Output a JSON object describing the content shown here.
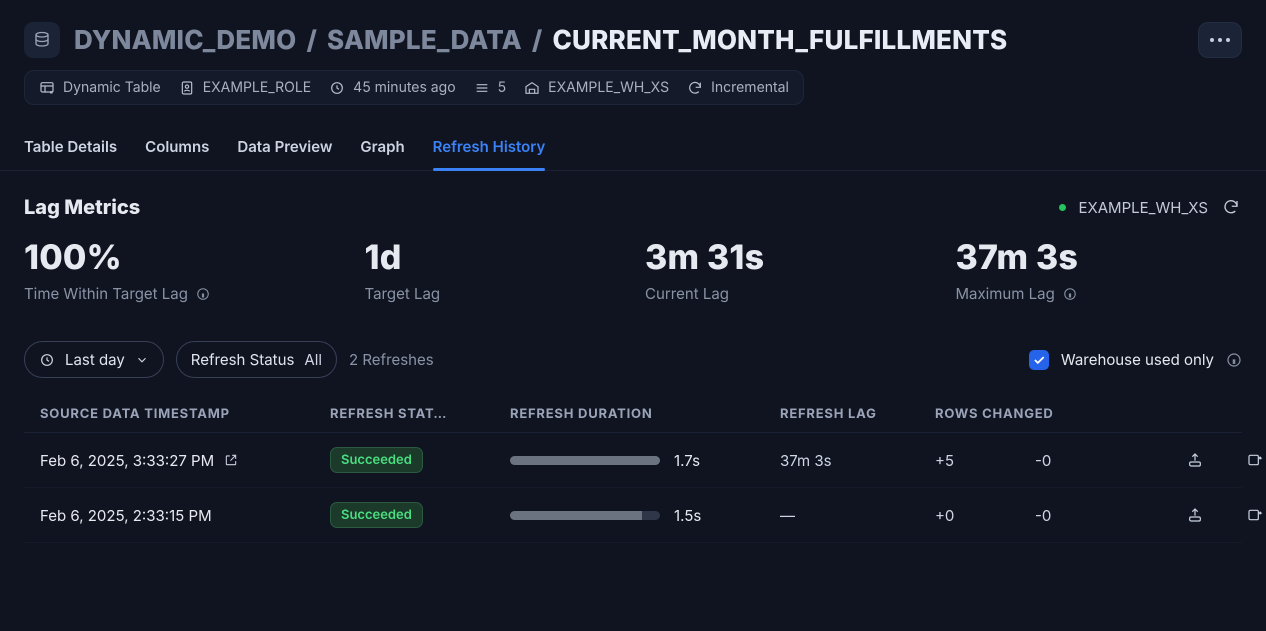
{
  "header": {
    "breadcrumb": {
      "seg1": "DYNAMIC_DEMO",
      "seg2": "SAMPLE_DATA",
      "seg3": "CURRENT_MONTH_FULFILLMENTS",
      "sep": " / "
    }
  },
  "chips": {
    "type": "Dynamic Table",
    "role": "EXAMPLE_ROLE",
    "age": "45 minutes ago",
    "rows": "5",
    "warehouse": "EXAMPLE_WH_XS",
    "refresh_mode": "Incremental"
  },
  "tabs": {
    "details": "Table Details",
    "columns": "Columns",
    "preview": "Data Preview",
    "graph": "Graph",
    "refresh": "Refresh History"
  },
  "lag": {
    "title": "Lag Metrics",
    "wh_name": "EXAMPLE_WH_XS",
    "metrics": [
      {
        "value": "100%",
        "label": "Time Within Target Lag",
        "info": true
      },
      {
        "value": "1d",
        "label": "Target Lag",
        "info": false
      },
      {
        "value": "3m 31s",
        "label": "Current Lag",
        "info": false
      },
      {
        "value": "37m 3s",
        "label": "Maximum Lag",
        "info": true
      }
    ]
  },
  "filters": {
    "range_label": "Last day",
    "status_label": "Refresh Status",
    "status_value": "All",
    "count_text": "2 Refreshes",
    "wh_only_label": "Warehouse used only"
  },
  "table": {
    "headers": {
      "ts": "SOURCE DATA TIMESTAMP",
      "status": "REFRESH STAT…",
      "duration": "REFRESH DURATION",
      "lag": "REFRESH LAG",
      "rows_changed": "ROWS CHANGED"
    },
    "rows": [
      {
        "ts": "Feb 6, 2025, 3:33:27 PM",
        "status": "Succeeded",
        "duration_text": "1.7s",
        "bar_pct": 100,
        "lag": "37m 3s",
        "rows_added": "+5",
        "rows_removed": "-0",
        "open_icon": true
      },
      {
        "ts": "Feb 6, 2025, 2:33:15 PM",
        "status": "Succeeded",
        "duration_text": "1.5s",
        "bar_pct": 88,
        "lag": "—",
        "rows_added": "+0",
        "rows_removed": "-0",
        "open_icon": false
      }
    ]
  }
}
